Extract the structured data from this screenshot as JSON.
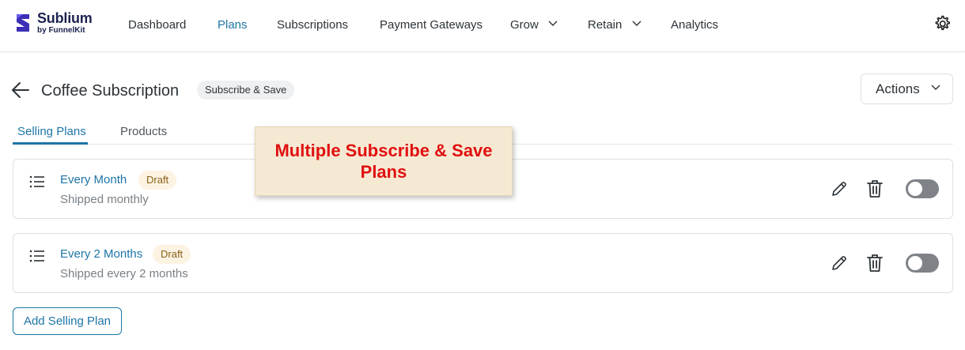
{
  "app": {
    "name": "Sublium",
    "byline": "by FunnelKit",
    "accent_color": "#1d75a6",
    "brand_color": "#3b2fb8"
  },
  "nav": {
    "items": [
      {
        "label": "Dashboard",
        "active": false,
        "dropdown": false
      },
      {
        "label": "Plans",
        "active": true,
        "dropdown": false
      },
      {
        "label": "Subscriptions",
        "active": false,
        "dropdown": false
      },
      {
        "label": "Payment Gateways",
        "active": false,
        "dropdown": false
      },
      {
        "label": "Grow",
        "active": false,
        "dropdown": true
      },
      {
        "label": "Retain",
        "active": false,
        "dropdown": true
      },
      {
        "label": "Analytics",
        "active": false,
        "dropdown": false
      }
    ],
    "settings_icon": "gear-icon"
  },
  "header": {
    "back_icon": "arrow-left-icon",
    "title": "Coffee Subscription",
    "type_badge": "Subscribe & Save",
    "actions_label": "Actions"
  },
  "tabs": [
    {
      "label": "Selling Plans",
      "active": true
    },
    {
      "label": "Products",
      "active": false
    }
  ],
  "plans": [
    {
      "name": "Every Month",
      "status": "Draft",
      "description": "Shipped monthly",
      "enabled": false
    },
    {
      "name": "Every 2 Months",
      "status": "Draft",
      "description": "Shipped every 2 months",
      "enabled": false
    }
  ],
  "add_button_label": "Add Selling Plan",
  "annotation": {
    "text": "Multiple Subscribe & Save Plans",
    "text_color": "#e01010",
    "background": "#f6e9d3"
  }
}
